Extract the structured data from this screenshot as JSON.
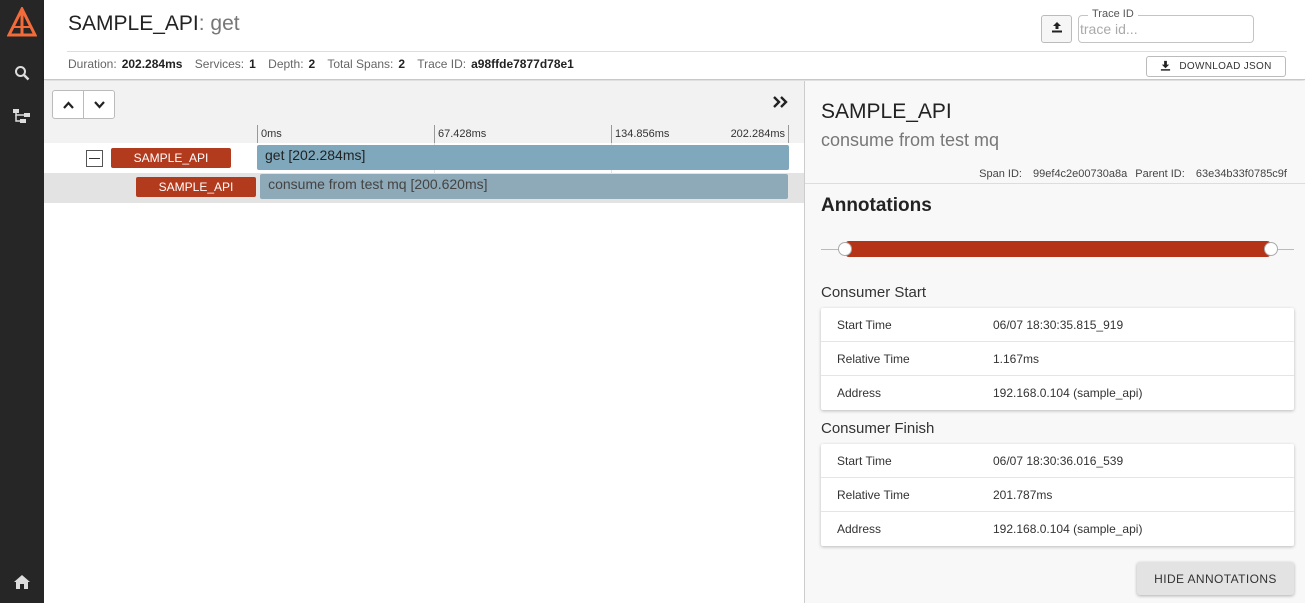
{
  "nav": {
    "logo": "zipkin-logo-icon",
    "items": [
      {
        "icon": "search-icon"
      },
      {
        "icon": "dependencies-icon"
      },
      {
        "icon": "home-icon"
      }
    ],
    "accent": "#f26b38"
  },
  "header": {
    "service": "SAMPLE_API",
    "separator": ":",
    "span_name": "get",
    "stats": {
      "duration_label": "Duration:",
      "duration": "202.284ms",
      "services_label": "Services:",
      "services": "1",
      "depth_label": "Depth:",
      "depth": "2",
      "total_spans_label": "Total Spans:",
      "total_spans": "2",
      "trace_id_label": "Trace ID:",
      "trace_id": "a98ffde7877d78e1"
    },
    "trace_id_input": {
      "legend": "Trace ID",
      "placeholder": "trace id...",
      "value": ""
    },
    "download_label": "DOWNLOAD JSON"
  },
  "timeline": {
    "ticks": [
      "0ms",
      "67.428ms",
      "134.856ms",
      "202.284ms"
    ],
    "total_ms": 202.284,
    "spans": [
      {
        "service": "SAMPLE_API",
        "label": "get [202.284ms]",
        "start_ms": 0,
        "duration_ms": 202.284,
        "depth": 0,
        "selected": false
      },
      {
        "service": "SAMPLE_API",
        "label": "consume from test mq [200.620ms]",
        "start_ms": 1.167,
        "duration_ms": 200.62,
        "depth": 1,
        "selected": true
      }
    ],
    "colors": {
      "service_badge": "#b23b1e",
      "span_bar": "#7fa8bd"
    }
  },
  "detail": {
    "service": "SAMPLE_API",
    "span_name": "consume from test mq",
    "span_id_label": "Span ID:",
    "span_id": "99ef4c2e00730a8a",
    "parent_id_label": "Parent ID:",
    "parent_id": "63e34b33f0785c9f",
    "annotations_title": "Annotations",
    "slider_color": "#b53316",
    "groups": [
      {
        "title": "Consumer Start",
        "rows": [
          {
            "key": "Start Time",
            "value": "06/07 18:30:35.815_919"
          },
          {
            "key": "Relative Time",
            "value": "1.167ms"
          },
          {
            "key": "Address",
            "value": "192.168.0.104 (sample_api)"
          }
        ]
      },
      {
        "title": "Consumer Finish",
        "rows": [
          {
            "key": "Start Time",
            "value": "06/07 18:30:36.016_539"
          },
          {
            "key": "Relative Time",
            "value": "201.787ms"
          },
          {
            "key": "Address",
            "value": "192.168.0.104 (sample_api)"
          }
        ]
      }
    ],
    "hide_label": "HIDE ANNOTATIONS"
  }
}
